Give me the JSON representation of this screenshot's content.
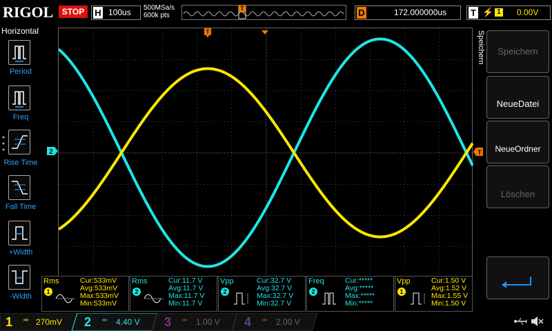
{
  "topbar": {
    "brand": "RIGOL",
    "run_state": "STOP",
    "horiz_badge": "H",
    "timebase": "100us",
    "sample_rate": "500MSa/s",
    "memory_depth": "600k pts",
    "trigger_marker": "T",
    "delay_badge": "D",
    "delay": "172.000000us",
    "trigger_badge": "T",
    "trigger_slope_icon": "rising-edge-icon",
    "trigger_source": "1",
    "trigger_level": "0.00V",
    "colors": {
      "stop": "#dd1111",
      "trigger": "#f07800",
      "ch1": "#ffe800",
      "ch2": "#1ee6e6"
    }
  },
  "left_menu": {
    "title": "Horizontal",
    "items": [
      {
        "label": "Period",
        "icon": "period-icon"
      },
      {
        "label": "Freq",
        "icon": "frequency-icon"
      },
      {
        "label": "Rise Time",
        "icon": "rise-time-icon"
      },
      {
        "label": "Fall Time",
        "icon": "fall-time-icon"
      },
      {
        "label": "+Width",
        "icon": "positive-width-icon"
      },
      {
        "label": "-Width",
        "icon": "negative-width-icon"
      }
    ]
  },
  "right_menu": {
    "title": "Speichern",
    "buttons": [
      {
        "label": "Speichern",
        "enabled": false
      },
      {
        "label": "NeueDatei",
        "enabled": true
      },
      {
        "label": "NeueOrdner",
        "enabled": true
      },
      {
        "label": "Löschen",
        "enabled": false
      },
      {
        "label": "",
        "icon": "return-arrow-icon"
      }
    ]
  },
  "waveform": {
    "ch2_offset_marker": "2",
    "trigger_level_marker": "T",
    "trigger_pos_marker": "T"
  },
  "measurements": [
    {
      "name": "Rms",
      "channel": "1",
      "cur": "Cur:533mV",
      "avg": "Avg:533mV",
      "max": "Max:533mV",
      "min": "Min:533mV"
    },
    {
      "name": "Rms",
      "channel": "2",
      "cur": "Cur:11.7 V",
      "avg": "Avg:11.7 V",
      "max": "Max:11.7 V",
      "min": "Min:11.7 V"
    },
    {
      "name": "Vpp",
      "channel": "2",
      "cur": "Cur:32.7 V",
      "avg": "Avg:32.7 V",
      "max": "Max:32.7 V",
      "min": "Min:32.7 V"
    },
    {
      "name": "Freq",
      "channel": "2",
      "cur": "Cur:*****",
      "avg": "Avg:*****",
      "max": "Max:*****",
      "min": "Min:*****"
    },
    {
      "name": "Vpp",
      "channel": "1",
      "cur": "Cur:1.50 V",
      "avg": "Avg:1.52 V",
      "max": "Max:1.55 V",
      "min": "Min:1.50 V"
    }
  ],
  "channels": [
    {
      "num": "1",
      "scale": "270mV",
      "color": "#ffe800",
      "active": true
    },
    {
      "num": "2",
      "scale": "4.40 V",
      "color": "#1ee6e6",
      "active": true
    },
    {
      "num": "3",
      "scale": "1.00 V",
      "color": "#c050c0",
      "active": false
    },
    {
      "num": "4",
      "scale": "2.00 V",
      "color": "#5a6ec8",
      "active": false
    }
  ],
  "status_icons": [
    "usb-icon",
    "speaker-muted-icon"
  ]
}
